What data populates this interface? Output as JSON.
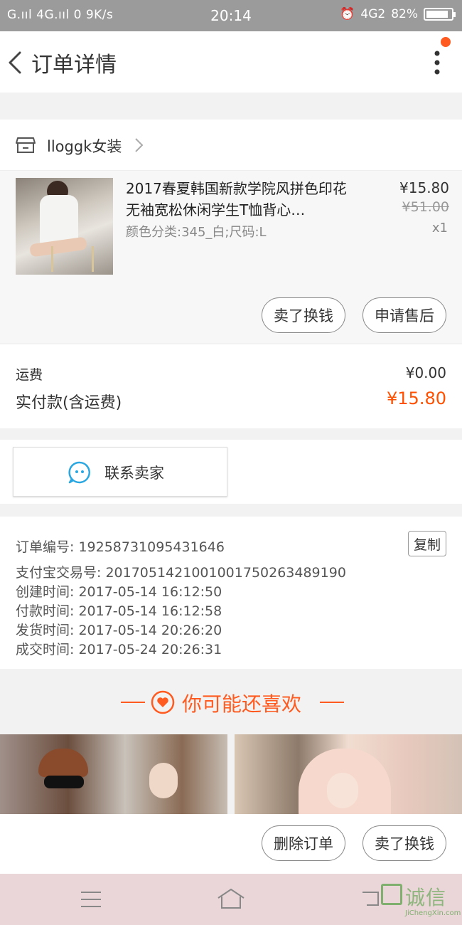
{
  "status_bar": {
    "left": "G.ııl 4G.ııl 0 9K/s",
    "time": "20:14",
    "network": "4G2",
    "battery": "82%"
  },
  "nav": {
    "title": "订单详情"
  },
  "shop": {
    "name": "lloggk女装"
  },
  "product": {
    "title": "2017春夏韩国新款学院风拼色印花无袖宽松休闲学生T恤背心…",
    "sku": "颜色分类:345_白;尺码:L",
    "price_now": "¥15.80",
    "price_old": "¥51.00",
    "quantity": "x1",
    "btn_sell": "卖了换钱",
    "btn_aftersale": "申请售后"
  },
  "shipping": {
    "label": "运费",
    "value": "¥0.00",
    "paid_label": "实付款(含运费)",
    "paid_value": "¥15.80"
  },
  "contact": {
    "label": "联系卖家"
  },
  "order_info": {
    "copy_label": "复制",
    "lines": [
      "订单编号: 19258731095431646",
      "支付宝交易号: 2017051421001001750263489190",
      "创建时间: 2017-05-14  16:12:50",
      "付款时间: 2017-05-14  16:12:58",
      "发货时间: 2017-05-14  20:26:20",
      "成交时间: 2017-05-24  20:26:31"
    ]
  },
  "recommend": {
    "title": "你可能还喜欢"
  },
  "actions": {
    "delete": "删除订单",
    "sell": "卖了换钱"
  },
  "watermark": {
    "text": "诚信",
    "sub": "JiChengXin.com"
  },
  "colors": {
    "accent": "#ff5000",
    "status_bar": "#9b9b9b",
    "system_nav": "#ead6d8"
  }
}
